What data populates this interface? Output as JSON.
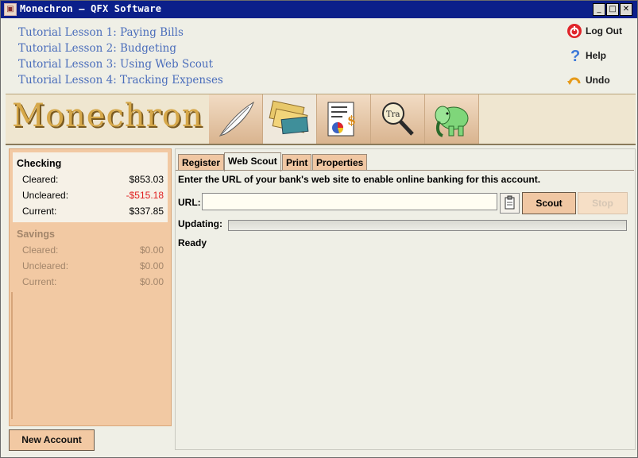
{
  "window": {
    "title": "Monechron – QFX Software"
  },
  "tutorial_links": [
    "Tutorial Lesson 1: Paying Bills",
    "Tutorial Lesson 2: Budgeting",
    "Tutorial Lesson 3: Using Web Scout",
    "Tutorial Lesson 4: Tracking Expenses"
  ],
  "actions": {
    "logout": "Log Out",
    "help": "Help",
    "undo": "Undo"
  },
  "brand": {
    "logo_text": "Monechron",
    "toolbar_icons": [
      "quill-pen-icon",
      "checks-and-cards-icon",
      "report-chart-icon",
      "magnifier-transaction-icon",
      "elephant-icon"
    ],
    "active_tool_index": 1
  },
  "accounts": {
    "checking": {
      "name": "Checking",
      "rows": [
        {
          "label": "Cleared:",
          "value": "$853.03"
        },
        {
          "label": "Uncleared:",
          "value": "-$515.18"
        },
        {
          "label": "Current:",
          "value": "$337.85"
        }
      ]
    },
    "savings": {
      "name": "Savings",
      "rows": [
        {
          "label": "Cleared:",
          "value": "$0.00"
        },
        {
          "label": "Uncleared:",
          "value": "$0.00"
        },
        {
          "label": "Current:",
          "value": "$0.00"
        }
      ]
    },
    "new_account_label": "New Account"
  },
  "tabs": [
    "Register",
    "Web Scout",
    "Print",
    "Properties"
  ],
  "active_tab": "Web Scout",
  "web_scout": {
    "instruction": "Enter the URL of your bank's web site to enable online banking for this account.",
    "url_label": "URL:",
    "url_value": "",
    "scout_label": "Scout",
    "stop_label": "Stop",
    "updating_label": "Updating:",
    "progress": 0,
    "status": "Ready"
  },
  "colors": {
    "link": "#4a6dbb",
    "negative": "#e02020",
    "panel": "#f2c9a3",
    "titlebar": "#0b1f8a"
  }
}
